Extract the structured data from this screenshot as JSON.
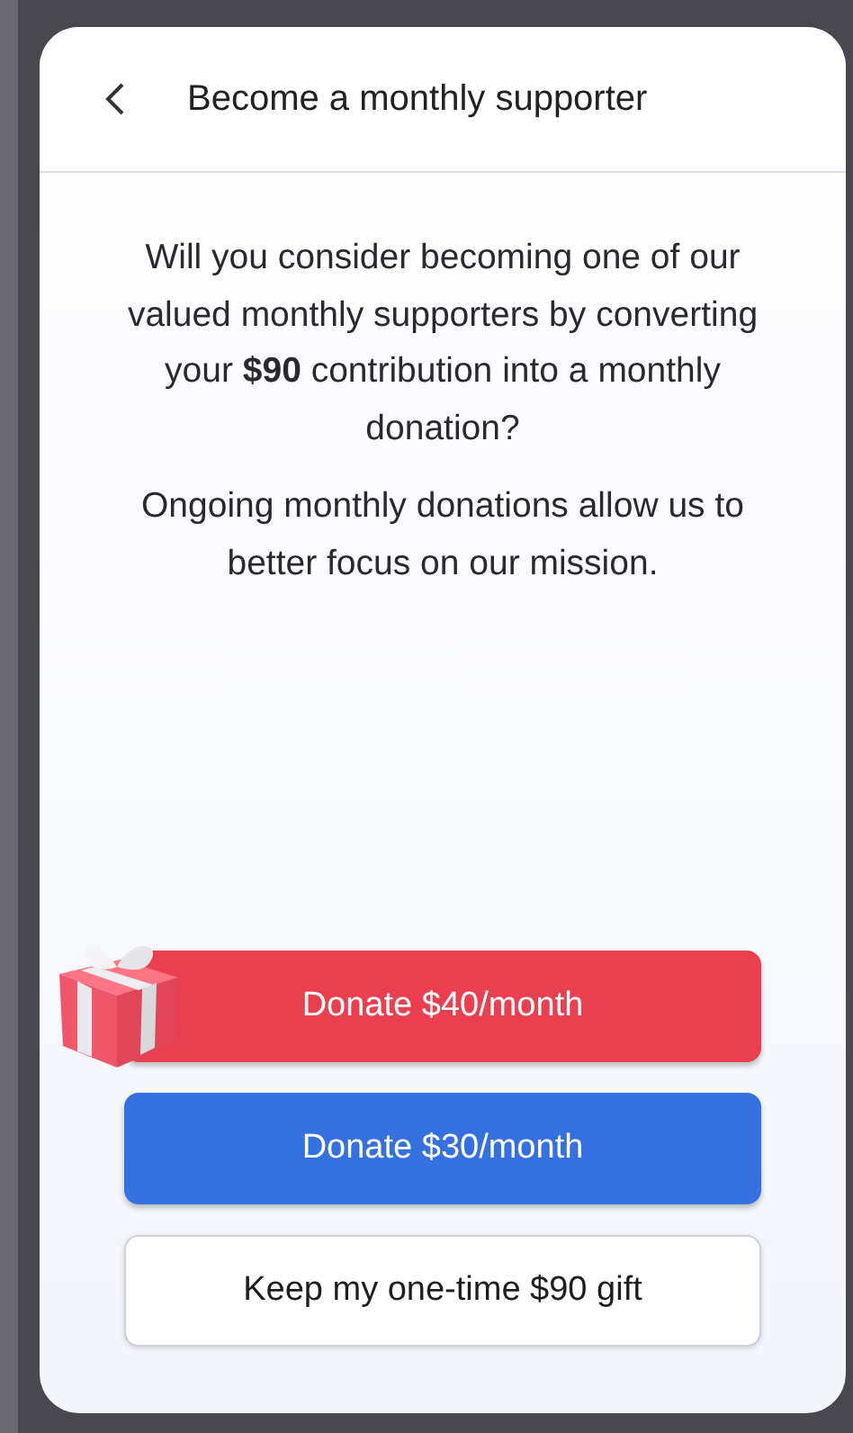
{
  "dialog": {
    "title": "Become a monthly supporter"
  },
  "paragraphs": [
    "Will you consider becoming one of our valued monthly supporters by converting your **$90** contribution into a monthly donation?",
    "Ongoing monthly donations allow us to better focus on our mission."
  ],
  "buttons": [
    {
      "label": "Donate $40/month",
      "kind": "featured"
    },
    {
      "label": "Donate $30/month",
      "kind": "primary"
    },
    {
      "label": "Keep my one-time $90 gift",
      "kind": "secondary"
    }
  ]
}
